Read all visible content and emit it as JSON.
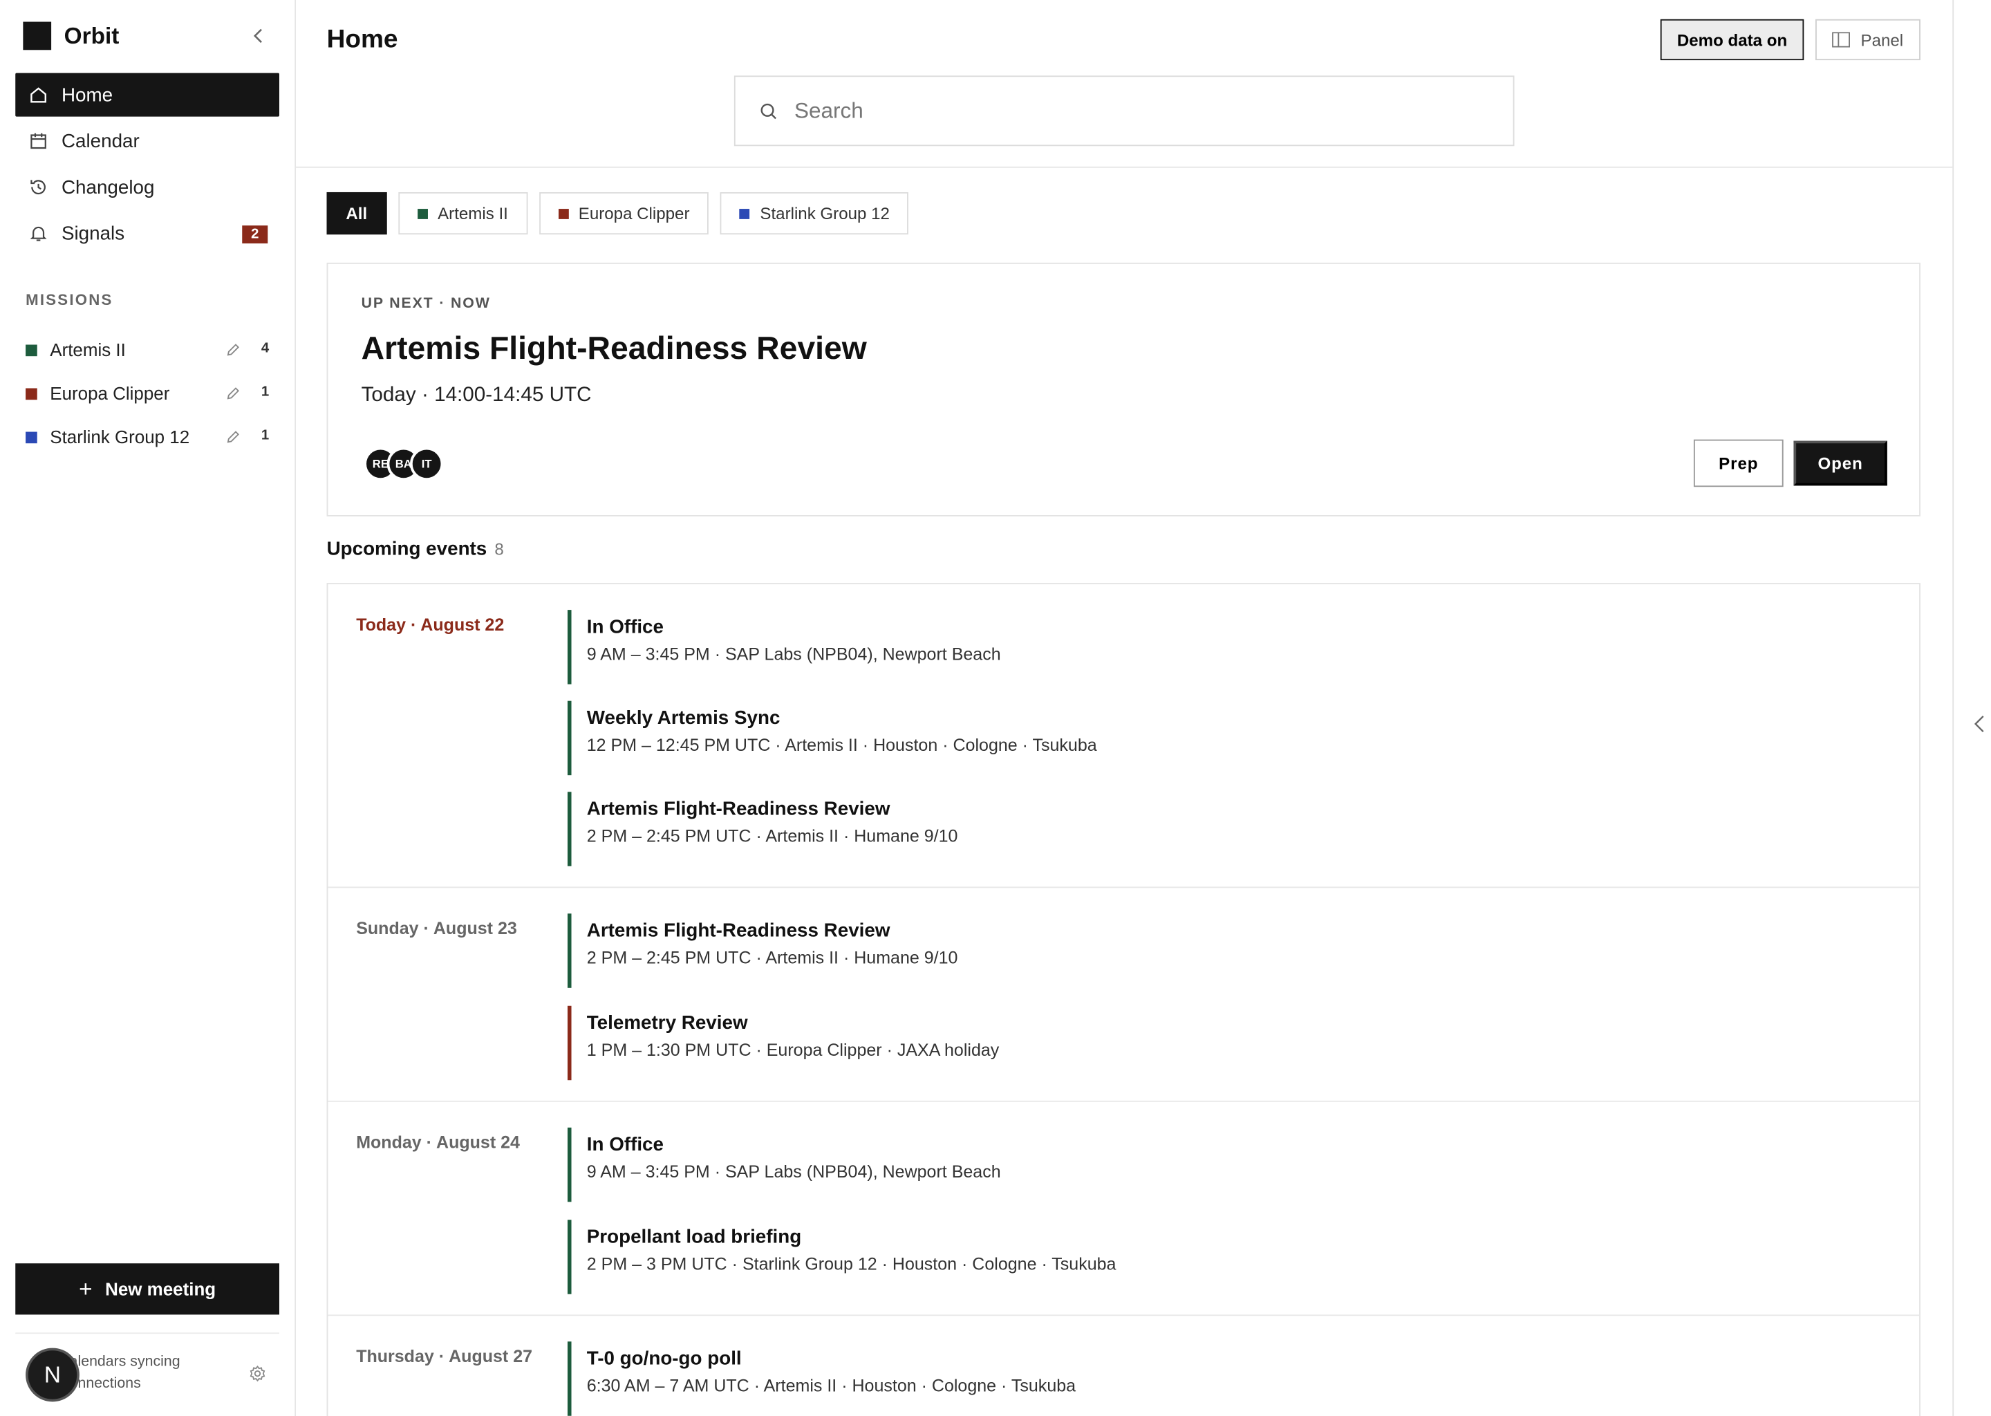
{
  "sidebar": {
    "brand": "Orbit",
    "nav": [
      {
        "label": "Home",
        "icon": "home-icon",
        "active": true
      },
      {
        "label": "Calendar",
        "icon": "calendar-icon"
      },
      {
        "label": "Changelog",
        "icon": "history-icon"
      },
      {
        "label": "Signals",
        "icon": "bell-icon",
        "badge": "2"
      }
    ],
    "section_label": "MISSIONS",
    "missions": [
      {
        "name": "Artemis II",
        "color": "#1d5c3d",
        "count": "4"
      },
      {
        "name": "Europa Clipper",
        "color": "#8b2a1a",
        "count": "1"
      },
      {
        "name": "Starlink Group 12",
        "color": "#2b49b5",
        "count": "1"
      }
    ],
    "new_meeting": "New meeting",
    "sync_line1": "Calendars syncing",
    "sync_line2": "Connections",
    "avatar_initial": "N"
  },
  "header": {
    "title": "Home",
    "search_placeholder": "Search",
    "demo_label": "Demo data on",
    "panel_label": "Panel"
  },
  "filters": [
    {
      "label": "All",
      "active": true
    },
    {
      "label": "Artemis II",
      "color": "#1d5c3d"
    },
    {
      "label": "Europa Clipper",
      "color": "#8b2a1a"
    },
    {
      "label": "Starlink Group 12",
      "color": "#2b49b5"
    }
  ],
  "upnext": {
    "label": "UP NEXT · NOW",
    "title": "Artemis Flight-Readiness Review",
    "time": "Today · 14:00-14:45 UTC",
    "attendees": [
      "RE",
      "BA",
      "IT"
    ],
    "prep": "Prep",
    "open": "Open"
  },
  "upcoming": {
    "title": "Upcoming events",
    "count": "8",
    "days": [
      {
        "label": "Today · August 22",
        "today": true,
        "events": [
          {
            "title": "In Office",
            "meta": "9 AM – 3:45 PM · SAP Labs (NPB04), Newport Beach",
            "color": "#1d5c3d"
          },
          {
            "title": "Weekly Artemis Sync",
            "meta": "12 PM – 12:45 PM UTC · Artemis II · Houston · Cologne · Tsukuba",
            "color": "#1d5c3d"
          },
          {
            "title": "Artemis Flight-Readiness Review",
            "meta": "2 PM – 2:45 PM UTC · Artemis II · Humane 9/10",
            "color": "#1d5c3d"
          }
        ]
      },
      {
        "label": "Sunday · August 23",
        "events": [
          {
            "title": "Artemis Flight-Readiness Review",
            "meta": "2 PM – 2:45 PM UTC · Artemis II · Humane 9/10",
            "color": "#1d5c3d"
          },
          {
            "title": "Telemetry Review",
            "meta": "1 PM – 1:30 PM UTC · Europa Clipper · JAXA holiday",
            "color": "#8b2a1a"
          }
        ]
      },
      {
        "label": "Monday · August 24",
        "events": [
          {
            "title": "In Office",
            "meta": "9 AM – 3:45 PM · SAP Labs (NPB04), Newport Beach",
            "color": "#1d5c3d"
          },
          {
            "title": "Propellant load briefing",
            "meta": "2 PM – 3 PM UTC · Starlink Group 12 · Houston · Cologne · Tsukuba",
            "color": "#1d5c3d"
          }
        ]
      },
      {
        "label": "Thursday · August 27",
        "events": [
          {
            "title": "T-0 go/no-go poll",
            "meta": "6:30 AM – 7 AM UTC · Artemis II · Houston · Cologne · Tsukuba",
            "color": "#1d5c3d"
          }
        ]
      }
    ]
  }
}
